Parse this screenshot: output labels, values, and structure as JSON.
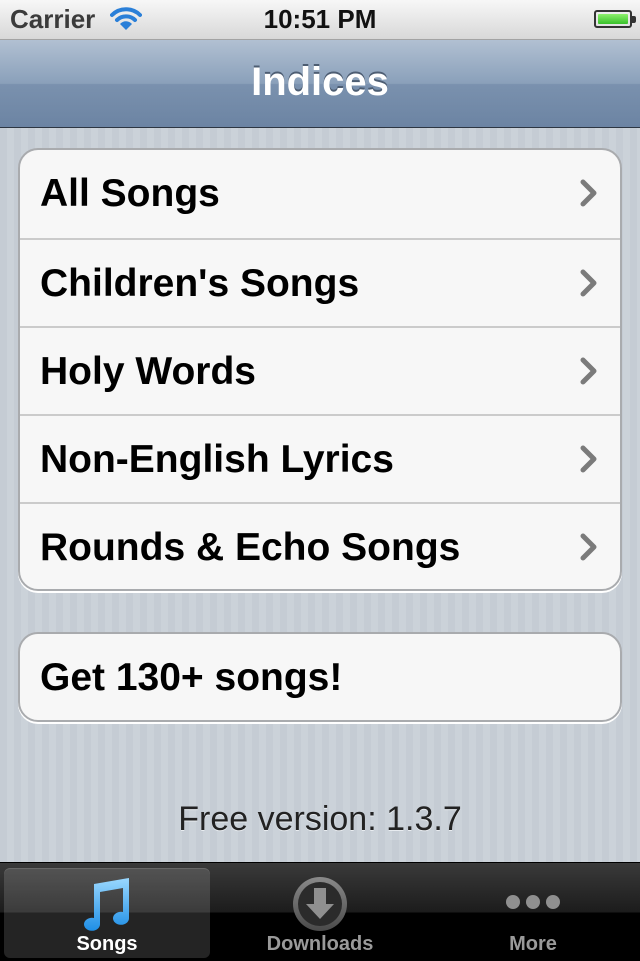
{
  "status_bar": {
    "carrier": "Carrier",
    "time": "10:51 PM",
    "battery_level": 1.0,
    "icons": [
      "wifi-icon",
      "battery-icon"
    ]
  },
  "nav": {
    "title": "Indices"
  },
  "indices": [
    {
      "label": "All Songs",
      "icon": "chevron-right-icon"
    },
    {
      "label": "Children's Songs",
      "icon": "chevron-right-icon"
    },
    {
      "label": "Holy Words",
      "icon": "chevron-right-icon"
    },
    {
      "label": "Non-English Lyrics",
      "icon": "chevron-right-icon"
    },
    {
      "label": "Rounds & Echo Songs",
      "icon": "chevron-right-icon"
    }
  ],
  "promo": {
    "label": "Get 130+ songs!"
  },
  "footer": {
    "version": "Free version: 1.3.7"
  },
  "tabs": [
    {
      "label": "Songs",
      "icon": "music-note-icon",
      "selected": true
    },
    {
      "label": "Downloads",
      "icon": "download-icon",
      "selected": false
    },
    {
      "label": "More",
      "icon": "more-dots-icon",
      "selected": false
    }
  ],
  "colors": {
    "nav_bar": "#7a91ae",
    "background": "#c5ccd4",
    "tab_selected_icon": "#4ab0f5",
    "battery_fill": "#38c12a"
  }
}
